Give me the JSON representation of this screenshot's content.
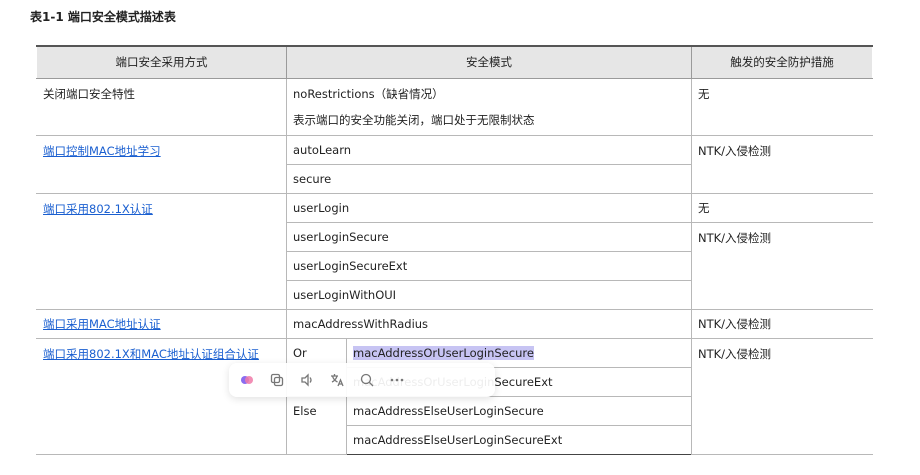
{
  "caption": "表1-1 端口安全模式描述表",
  "headers": [
    "端口安全采用方式",
    "安全模式",
    "触发的安全防护措施"
  ],
  "rows": {
    "r1": {
      "method": "关闭端口安全特性",
      "mode_line1": "noRestrictions（缺省情况）",
      "mode_line2": "表示端口的安全功能关闭，端口处于无限制状态",
      "action": "无"
    },
    "r2": {
      "method": "端口控制MAC地址学习",
      "modes": [
        "autoLearn",
        "secure"
      ],
      "action": "NTK/入侵检测"
    },
    "r3": {
      "method": "端口采用802.1X认证",
      "modes": [
        "userLogin",
        "userLoginSecure",
        "userLoginSecureExt",
        "userLoginWithOUI"
      ],
      "action_first": "无",
      "action_rest": "NTK/入侵检测"
    },
    "r4": {
      "method": "端口采用MAC地址认证",
      "mode": "macAddressWithRadius",
      "action": "NTK/入侵检测"
    },
    "r5": {
      "method": "端口采用802.1X和MAC地址认证组合认证",
      "or_label": "Or",
      "else_label": "Else",
      "or_modes": [
        "macAddressOrUserLoginSecure",
        "macAddressOrUserLoginSecureExt"
      ],
      "else_modes": [
        "macAddressElseUserLoginSecure",
        "macAddressElseUserLoginSecureExt"
      ],
      "action": "NTK/入侵检测"
    }
  },
  "toolbar_icons": [
    "ai-assistant-icon",
    "copy-icon",
    "read-aloud-icon",
    "translate-icon",
    "search-icon",
    "more-icon"
  ]
}
